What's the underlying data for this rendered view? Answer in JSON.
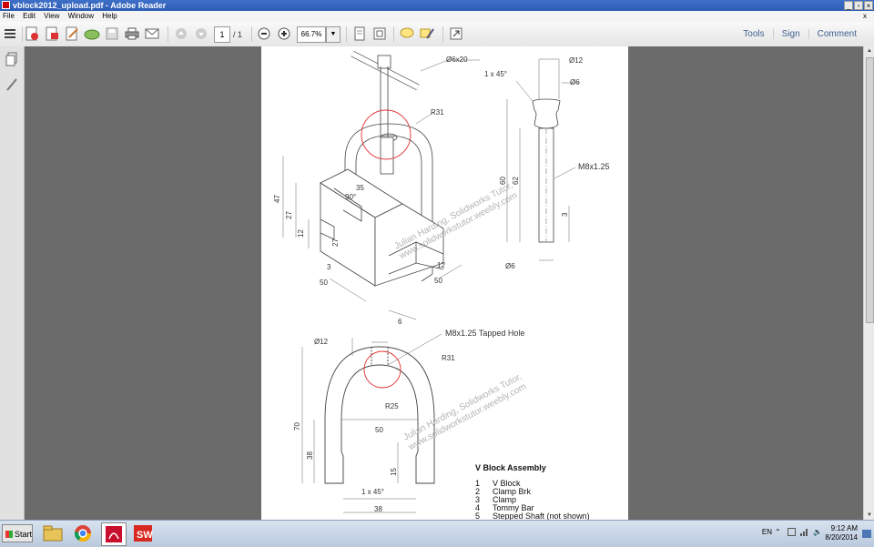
{
  "window": {
    "title": "vblock2012_upload.pdf - Adobe Reader"
  },
  "menu": {
    "items": [
      "File",
      "Edit",
      "View",
      "Window",
      "Help"
    ],
    "close": "x"
  },
  "toolbar": {
    "page_current": "1",
    "page_total": "/ 1",
    "zoom": "66.7%",
    "right_links": [
      "Tools",
      "Sign",
      "Comment"
    ]
  },
  "drawing": {
    "watermark_line1": "Julian Harding, Solidworks Tutor,",
    "watermark_line2": "www.solidworkstutor.weebly.com",
    "iso": {
      "d6x20": "Ø6x20",
      "r31": "R31",
      "h47": "47",
      "h27": "27",
      "h12": "12",
      "a35": "35",
      "a90": "90°",
      "b27": "27",
      "d3": "3",
      "d50a": "50",
      "d50b": "50",
      "d12": "12",
      "d6": "6"
    },
    "shaft": {
      "cham": "1 x 45°",
      "d12": "Ø12",
      "d6top": "Ø6",
      "thread": "M8x1.25",
      "len60": "60",
      "len62": "62",
      "len3": "3",
      "d6bot": "Ø6"
    },
    "clamp": {
      "d12": "Ø12",
      "tapped": "M8x1.25 Tapped Hole",
      "r31": "R31",
      "r25": "R25",
      "w50": "50",
      "h70": "70",
      "h38": "38",
      "h15": "15",
      "cham": "1 x 45°",
      "w38": "38"
    },
    "bom": {
      "title": "V Block Assembly",
      "items": [
        {
          "n": "1",
          "name": "V Block"
        },
        {
          "n": "2",
          "name": "Clamp Brk"
        },
        {
          "n": "3",
          "name": "Clamp"
        },
        {
          "n": "4",
          "name": "Tommy Bar"
        },
        {
          "n": "5",
          "name": "Stepped Shaft (not shown)"
        }
      ]
    }
  },
  "taskbar": {
    "start": "Start",
    "lang": "EN",
    "time": "9:12 AM",
    "date": "8/20/2014"
  }
}
